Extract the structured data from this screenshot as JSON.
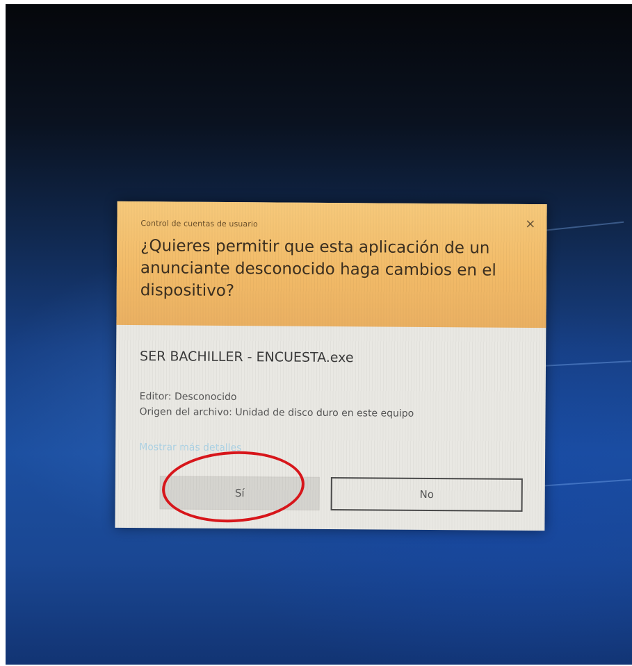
{
  "dialog": {
    "caption": "Control de cuentas de usuario",
    "close_glyph": "×",
    "close_icon": "close-icon",
    "question": "¿Quieres permitir que esta aplicación de un anunciante desconocido haga cambios en el dispositivo?",
    "filename": "SER BACHILLER - ENCUESTA.exe",
    "publisher": "Editor: Desconocido",
    "origin": "Origen del archivo: Unidad de disco duro en este equipo",
    "details_link": "Mostrar más detalles",
    "yes_label": "Sí",
    "no_label": "No",
    "header_color": "#f2bb68",
    "body_color": "#e9e8e3"
  },
  "annotation": {
    "highlight_color": "#d7161b",
    "highlight_target": "yes-button"
  }
}
